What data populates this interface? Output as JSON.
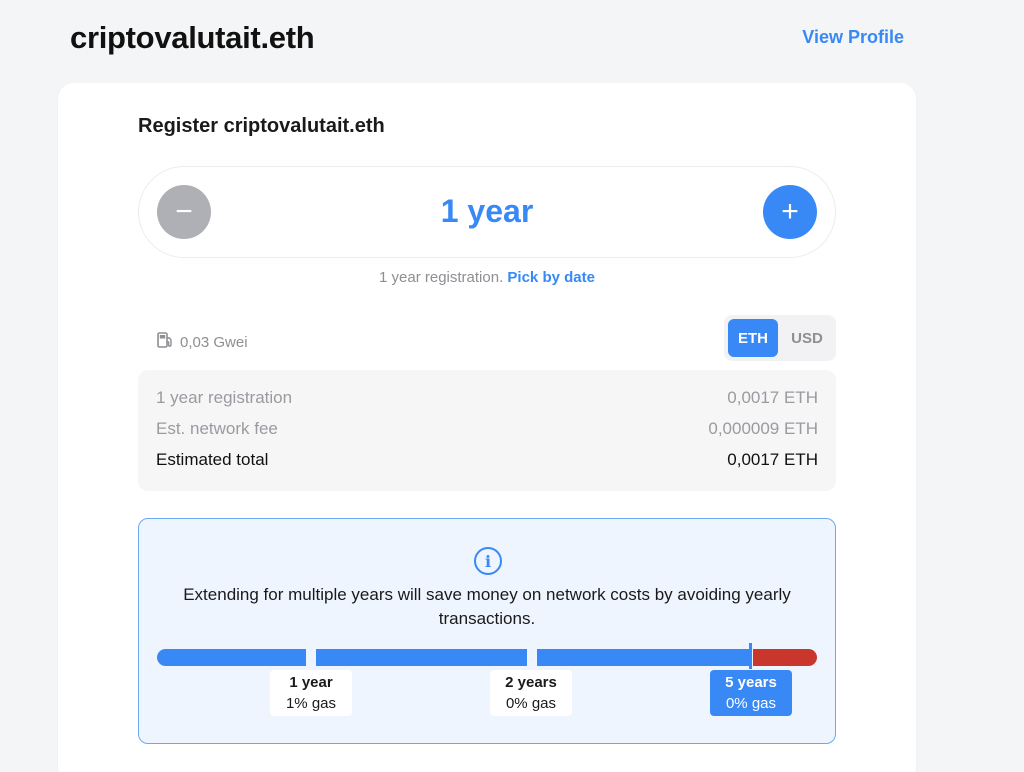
{
  "header": {
    "title": "criptovalutait.eth",
    "view_profile": "View Profile"
  },
  "register": {
    "title": "Register criptovalutait.eth",
    "duration_label": "1 year",
    "minus_symbol": "−",
    "plus_symbol": "+",
    "registration_text": "1 year registration.",
    "pick_by_date": "Pick by date"
  },
  "gas": {
    "icon": "gas-pump-icon",
    "value": "0,03 Gwei"
  },
  "currency": {
    "options": [
      "ETH",
      "USD"
    ],
    "selected": "ETH"
  },
  "pricing": {
    "rows": [
      {
        "label": "1 year registration",
        "value": "0,0017 ETH"
      },
      {
        "label": "Est. network fee",
        "value": "0,000009 ETH"
      },
      {
        "label": "Estimated total",
        "value": "0,0017 ETH"
      }
    ]
  },
  "info": {
    "icon": "info-icon",
    "text": "Extending for multiple years will save money on network costs by avoiding yearly transactions.",
    "markers": [
      {
        "years": "1 year",
        "gas": "1% gas"
      },
      {
        "years": "2 years",
        "gas": "0% gas"
      },
      {
        "years": "5 years",
        "gas": "0% gas"
      }
    ],
    "selected_marker": "5 years"
  },
  "colors": {
    "accent": "#3889f5",
    "warning": "#c9362c",
    "muted": "#8e8e93"
  }
}
